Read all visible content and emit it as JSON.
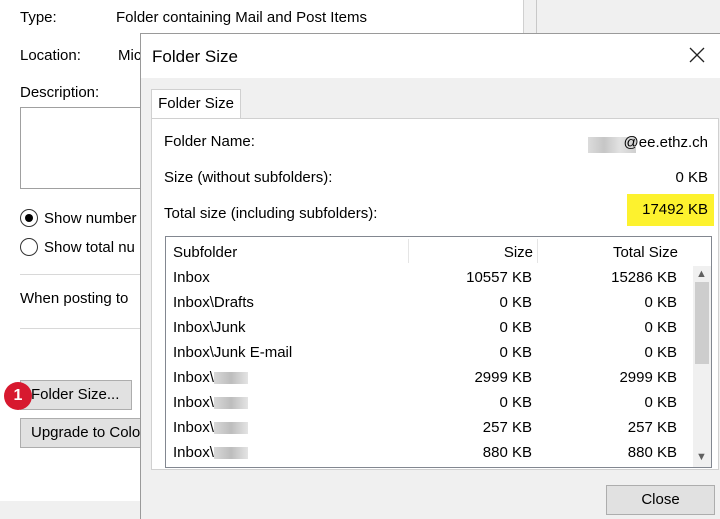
{
  "background_dialog": {
    "type_label": "Type:",
    "type_value": "Folder containing Mail and Post Items",
    "location_label": "Location:",
    "location_value": "Mic",
    "description_label": "Description:",
    "radio_1_label": "Show number",
    "radio_2_label": "Show total nu",
    "posting_label": "When posting to",
    "folder_size_button": "Folder Size...",
    "upgrade_button": "Upgrade to Colo",
    "step_badge": "1"
  },
  "modal": {
    "title": "Folder Size",
    "tab_label": "Folder Size",
    "folder_name_label": "Folder Name:",
    "folder_name_value": "@ee.ethz.ch",
    "size_label": "Size (without subfolders):",
    "size_value": "0 KB",
    "total_label": "Total size (including subfolders):",
    "total_value": "17492 KB",
    "highlight_color": "#fdf22e",
    "close_button": "Close"
  },
  "subfolders": {
    "headers": [
      "Subfolder",
      "Size",
      "Total Size"
    ],
    "rows": [
      {
        "name": "Inbox",
        "size": "10557 KB",
        "total": "15286 KB"
      },
      {
        "name": "Inbox\\Drafts",
        "size": "0 KB",
        "total": "0 KB"
      },
      {
        "name": "Inbox\\Junk",
        "size": "0 KB",
        "total": "0 KB"
      },
      {
        "name": "Inbox\\Junk E-mail",
        "size": "0 KB",
        "total": "0 KB"
      },
      {
        "name": "Inbox\\",
        "size": "2999 KB",
        "total": "2999 KB"
      },
      {
        "name": "Inbox\\",
        "size": "0 KB",
        "total": "0 KB"
      },
      {
        "name": "Inbox\\",
        "size": "257 KB",
        "total": "257 KB"
      },
      {
        "name": "Inbox\\",
        "size": "880 KB",
        "total": "880 KB"
      }
    ]
  },
  "icons": {
    "close": "close-icon",
    "scroll_up": "chevron-up-icon",
    "scroll_down": "chevron-down-icon"
  }
}
